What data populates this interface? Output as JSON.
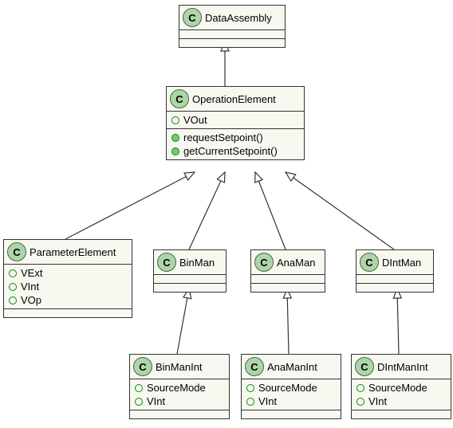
{
  "diagram": {
    "type": "uml-class-diagram",
    "classes": {
      "DataAssembly": {
        "name": "DataAssembly",
        "attributes": [],
        "methods": []
      },
      "OperationElement": {
        "name": "OperationElement",
        "attributes": [
          "VOut"
        ],
        "methods": [
          "requestSetpoint()",
          "getCurrentSetpoint()"
        ]
      },
      "ParameterElement": {
        "name": "ParameterElement",
        "attributes": [
          "VExt",
          "VInt",
          "VOp"
        ],
        "methods": []
      },
      "BinMan": {
        "name": "BinMan",
        "attributes": [],
        "methods": []
      },
      "AnaMan": {
        "name": "AnaMan",
        "attributes": [],
        "methods": []
      },
      "DIntMan": {
        "name": "DIntMan",
        "attributes": [],
        "methods": []
      },
      "BinManInt": {
        "name": "BinManInt",
        "attributes": [
          "SourceMode",
          "VInt"
        ],
        "methods": []
      },
      "AnaManInt": {
        "name": "AnaManInt",
        "attributes": [
          "SourceMode",
          "VInt"
        ],
        "methods": []
      },
      "DIntManInt": {
        "name": "DIntManInt",
        "attributes": [
          "SourceMode",
          "VInt"
        ],
        "methods": []
      }
    },
    "inheritance": [
      {
        "child": "OperationElement",
        "parent": "DataAssembly"
      },
      {
        "child": "ParameterElement",
        "parent": "OperationElement"
      },
      {
        "child": "BinMan",
        "parent": "OperationElement"
      },
      {
        "child": "AnaMan",
        "parent": "OperationElement"
      },
      {
        "child": "DIntMan",
        "parent": "OperationElement"
      },
      {
        "child": "BinManInt",
        "parent": "BinMan"
      },
      {
        "child": "AnaManInt",
        "parent": "AnaMan"
      },
      {
        "child": "DIntManInt",
        "parent": "DIntMan"
      }
    ],
    "stereotype_letter": "C"
  }
}
